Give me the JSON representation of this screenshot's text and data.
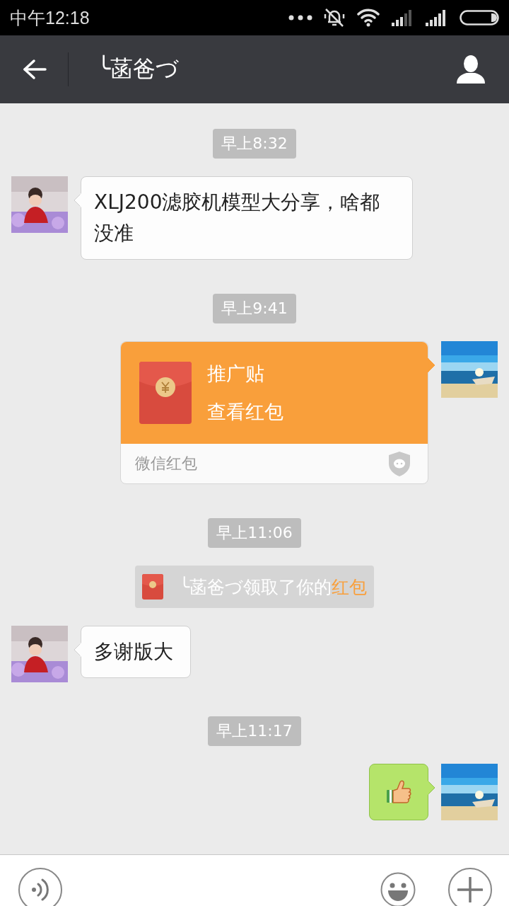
{
  "status_bar": {
    "time": "中午12:18"
  },
  "header": {
    "title": "╰菡爸づ"
  },
  "messages": [
    {
      "kind": "time",
      "text": "早上8:32"
    },
    {
      "kind": "text",
      "outgoing": false,
      "text": "XLJ200滤胶机模型大分享，啥都没准"
    },
    {
      "kind": "time",
      "text": "早上9:41"
    },
    {
      "kind": "red_packet",
      "outgoing": true,
      "title": "推广贴",
      "action": "查看红包",
      "footer": "微信红包"
    },
    {
      "kind": "time",
      "text": "早上11:06"
    },
    {
      "kind": "system",
      "text": "╰菡爸づ领取了你的",
      "link": "红包"
    },
    {
      "kind": "text",
      "outgoing": false,
      "text": "多谢版大"
    },
    {
      "kind": "time",
      "text": "早上11:17"
    },
    {
      "kind": "sticker",
      "outgoing": true
    }
  ]
}
